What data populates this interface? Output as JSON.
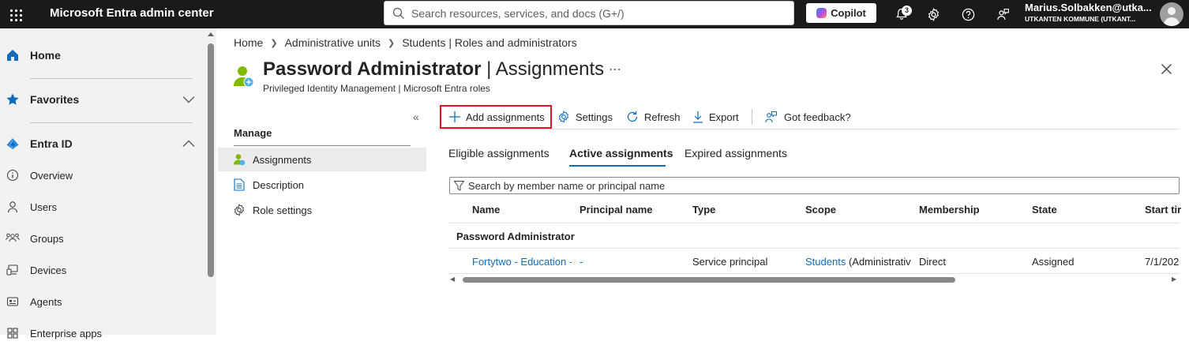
{
  "topbar": {
    "app_title": "Microsoft Entra admin center",
    "search_placeholder": "Search resources, services, and docs (G+/)",
    "copilot_label": "Copilot",
    "notification_count": "3",
    "user_email": "Marius.Solbakken@utka...",
    "user_tenant": "UTKANTEN KOMMUNE (UTKANT..."
  },
  "leftnav": {
    "home": "Home",
    "favorites": "Favorites",
    "entra_id": "Entra ID",
    "items": [
      {
        "label": "Overview",
        "icon": "info-icon"
      },
      {
        "label": "Users",
        "icon": "user-icon"
      },
      {
        "label": "Groups",
        "icon": "groups-icon"
      },
      {
        "label": "Devices",
        "icon": "devices-icon"
      },
      {
        "label": "Agents",
        "icon": "agents-icon"
      },
      {
        "label": "Enterprise apps",
        "icon": "enterprise-apps-icon"
      }
    ]
  },
  "breadcrumb": [
    "Home",
    "Administrative units",
    "Students | Roles and administrators"
  ],
  "page": {
    "title_bold": "Password Administrator",
    "title_rest": "Assignments",
    "subtitle": "Privileged Identity Management | Microsoft Entra roles"
  },
  "manage": {
    "header": "Manage",
    "items": [
      {
        "label": "Assignments",
        "selected": true
      },
      {
        "label": "Description",
        "selected": false
      },
      {
        "label": "Role settings",
        "selected": false
      }
    ]
  },
  "toolbar": {
    "add": "Add assignments",
    "settings": "Settings",
    "refresh": "Refresh",
    "export": "Export",
    "feedback": "Got feedback?"
  },
  "tabs": [
    "Eligible assignments",
    "Active assignments",
    "Expired assignments"
  ],
  "active_tab": "Active assignments",
  "filter_placeholder": "Search by member name or principal name",
  "table": {
    "columns": [
      "Name",
      "Principal name",
      "Type",
      "Scope",
      "Membership",
      "State",
      "Start tir"
    ],
    "group": "Password Administrator",
    "rows": [
      {
        "name": "Fortytwo - Education -",
        "principal": "-",
        "type": "Service principal",
        "scope_link": "Students",
        "scope_rest": " (Administrativ",
        "membership": "Direct",
        "state": "Assigned",
        "start": "7/1/202"
      }
    ]
  },
  "colors": {
    "accent": "#0f6cbd",
    "topbar": "#1b1a19",
    "highlight_border": "#e81123"
  }
}
